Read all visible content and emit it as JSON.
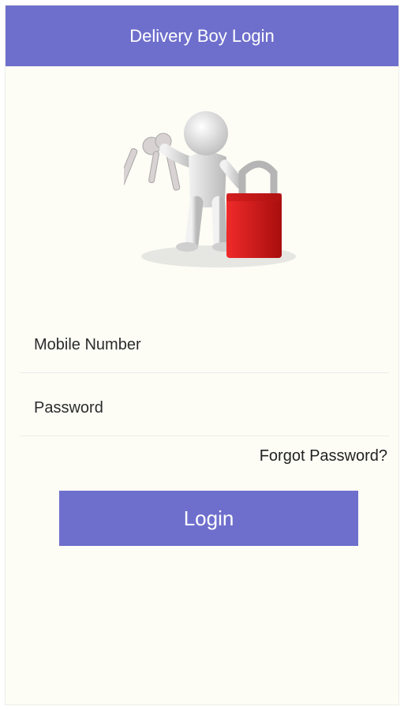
{
  "header": {
    "title": "Delivery Boy Login"
  },
  "illustration": {
    "icon": "person-with-keys-and-padlock"
  },
  "form": {
    "mobile": {
      "placeholder": "Mobile Number",
      "value": ""
    },
    "password": {
      "placeholder": "Password",
      "value": ""
    },
    "forgot_label": "Forgot Password?",
    "login_label": "Login"
  },
  "colors": {
    "accent": "#6e6fcc",
    "background": "#fdfdf6",
    "lock_red": "#d71a1a"
  }
}
